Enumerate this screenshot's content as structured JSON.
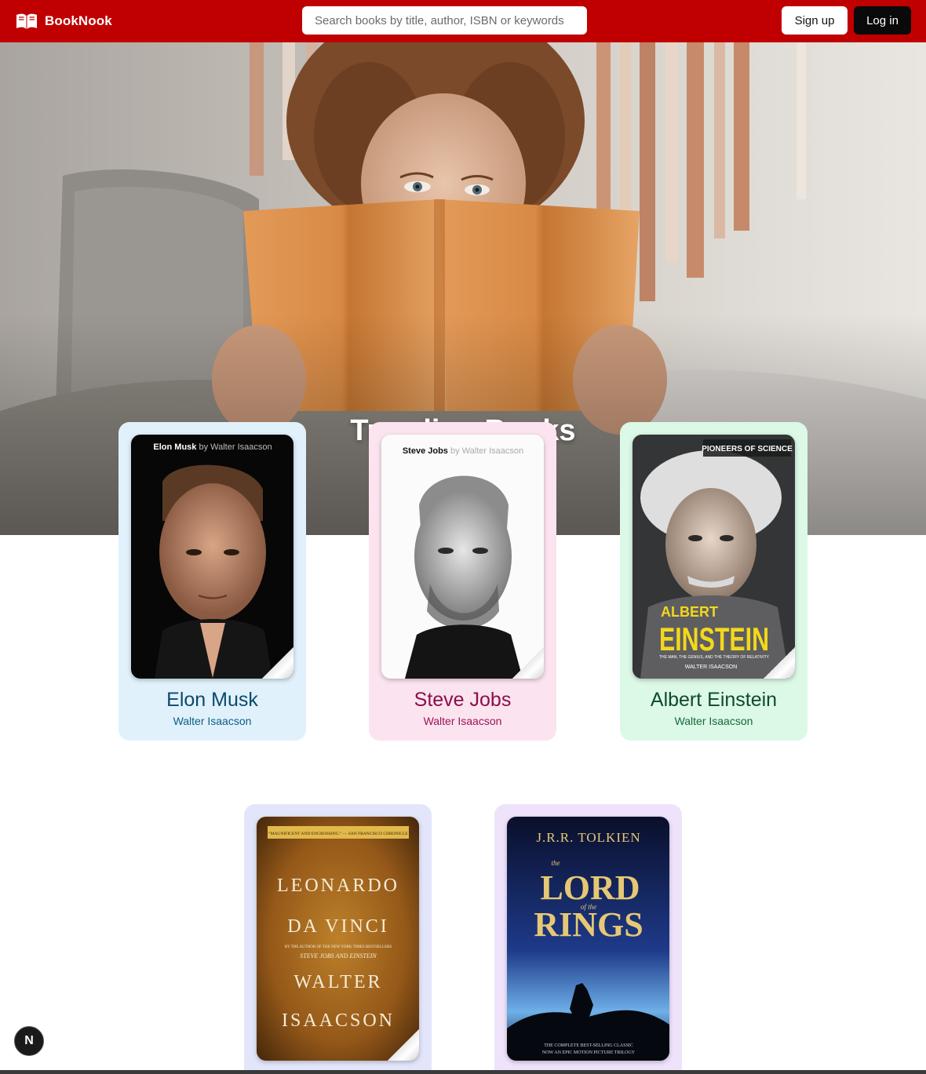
{
  "header": {
    "brand": "BookNook",
    "search_placeholder": "Search books by title, author, ISBN or keywords",
    "signup_label": "Sign up",
    "login_label": "Log in",
    "bg_color": "#c00000"
  },
  "hero": {
    "title": "Trending Books"
  },
  "books": [
    {
      "title": "Elon Musk",
      "author": "Walter Isaacson",
      "card_bg": "#e0f1fb",
      "title_color": "#0b4a6b",
      "author_color": "#0b5d86",
      "cover_text": {
        "name": "Elon Musk",
        "by": "by Walter Isaacson"
      }
    },
    {
      "title": "Steve Jobs",
      "author": "Walter Isaacson",
      "card_bg": "#fbe3ef",
      "title_color": "#8a0f4b",
      "author_color": "#9b1457",
      "cover_text": {
        "name": "Steve Jobs",
        "by": "by Walter Isaacson"
      }
    },
    {
      "title": "Albert Einstein",
      "author": "Walter Isaacson",
      "card_bg": "#dcf8e6",
      "title_color": "#0d4a2b",
      "author_color": "#14693c",
      "cover_text": {
        "series": "PIONEERS OF SCIENCE",
        "first": "ALBERT",
        "last": "EINSTEIN",
        "sub": "THE MAN, THE GENIUS, AND THE THEORY OF RELATIVITY",
        "author": "WALTER ISAACSON"
      }
    },
    {
      "title": "Leonardo da Vinci",
      "author": "Walter Isaacson",
      "card_bg": "#e3e6fb",
      "cover_text": {
        "blurb": "“MAGNIFICENT AND ENGROSSING.” — SAN FRANCISCO CHRONICLE",
        "line1": "LEONARDO",
        "line2": "DA VINCI",
        "small1": "BY THE AUTHOR OF THE NEW YORK TIMES BESTSELLERS",
        "small2": "STEVE JOBS AND EINSTEIN",
        "line3": "WALTER",
        "line4": "ISAACSON"
      }
    },
    {
      "title": "The Lord of the Rings",
      "author": "J.R.R. Tolkien",
      "card_bg": "#efe3fb",
      "cover_text": {
        "author": "J.R.R. TOLKIEN",
        "the": "the",
        "lord": "LORD",
        "ofthe": "of the",
        "rings": "RINGS",
        "bottom1": "THE COMPLETE BEST-SELLING CLASSIC",
        "bottom2": "NOW AN EPIC MOTION PICTURE TRILOGY"
      }
    }
  ],
  "floating_badge": {
    "label": "N"
  }
}
